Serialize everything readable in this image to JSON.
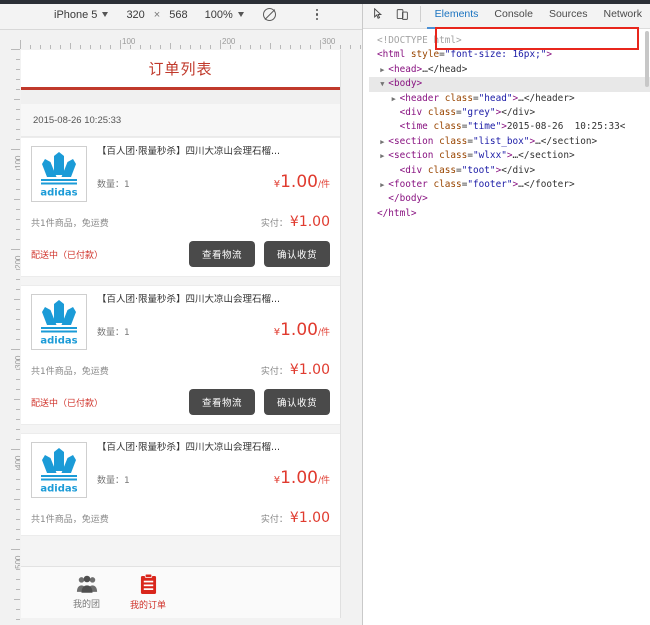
{
  "device_toolbar": {
    "device_name": "iPhone 5",
    "width": "320",
    "height": "568",
    "separator": "×",
    "zoom": "100%",
    "throttle_icon": "no-throttling-icon",
    "more_icon": "more-vertical-icon"
  },
  "rulers": {
    "horizontal_labels": [
      "100",
      "200",
      "300"
    ],
    "vertical_labels": [
      "100",
      "200",
      "300",
      "400",
      "500"
    ]
  },
  "phone": {
    "header_title": "订单列表",
    "time": "2015-08-26 10:25:33",
    "orders": [
      {
        "thumb_alt": "adidas-logo",
        "title": "【百人团·限量秒杀】四川大凉山会理石榴...",
        "qty_label": "数量：1",
        "unit_currency": "¥",
        "unit_price": "1.00",
        "unit_suffix": "/件",
        "summary_left": "共1件商品，免运费",
        "summary_right_label": "实付：",
        "summary_currency": "¥",
        "summary_amount": "1.00",
        "status": "配送中（已付款）",
        "btn_logistics": "查看物流",
        "btn_confirm": "确认收货"
      },
      {
        "thumb_alt": "adidas-logo",
        "title": "【百人团·限量秒杀】四川大凉山会理石榴...",
        "qty_label": "数量：1",
        "unit_currency": "¥",
        "unit_price": "1.00",
        "unit_suffix": "/件",
        "summary_left": "共1件商品，免运费",
        "summary_right_label": "实付：",
        "summary_currency": "¥",
        "summary_amount": "1.00",
        "status": "配送中（已付款）",
        "btn_logistics": "查看物流",
        "btn_confirm": "确认收货"
      },
      {
        "thumb_alt": "adidas-logo",
        "title": "【百人团·限量秒杀】四川大凉山会理石榴...",
        "qty_label": "数量：1",
        "unit_currency": "¥",
        "unit_price": "1.00",
        "unit_suffix": "/件",
        "summary_left": "共1件商品，免运费",
        "summary_right_label": "实付：",
        "summary_currency": "¥",
        "summary_amount": "1.00",
        "status": "",
        "btn_logistics": "",
        "btn_confirm": ""
      }
    ],
    "tabbar": [
      {
        "label": "我的团",
        "icon": "group-people-icon",
        "active": false
      },
      {
        "label": "我的订单",
        "icon": "clipboard-list-icon",
        "active": true
      }
    ]
  },
  "devtools": {
    "inspect_icon": "inspect-cursor-icon",
    "device_toggle_icon": "device-toolbar-icon",
    "tabs": [
      {
        "label": "Elements",
        "active": true
      },
      {
        "label": "Console",
        "active": false
      },
      {
        "label": "Sources",
        "active": false
      },
      {
        "label": "Network",
        "active": false
      }
    ],
    "dom_lines": [
      {
        "indent": 0,
        "arrow": "",
        "text": "<!DOCTYPE html>",
        "kind": "doctype"
      },
      {
        "indent": 0,
        "arrow": "",
        "text": "<html style=\"font-size: 16px;\">",
        "kind": "tag"
      },
      {
        "indent": 1,
        "arrow": "▶",
        "text": "<head>…</head>",
        "kind": "tag"
      },
      {
        "indent": 1,
        "arrow": "▼",
        "text": "<body>",
        "kind": "tag",
        "selected": true
      },
      {
        "indent": 2,
        "arrow": "▶",
        "text": "<header class=\"head\">…</header>",
        "kind": "tag"
      },
      {
        "indent": 2,
        "arrow": "",
        "text": "<div class=\"grey\"></div>",
        "kind": "tag"
      },
      {
        "indent": 2,
        "arrow": "",
        "text": "<time class=\"time\">2015-08-26  10:25:33<",
        "kind": "tag"
      },
      {
        "indent": 1,
        "arrow": "▶",
        "text": "<section class=\"list_box\">…</section>",
        "kind": "tag"
      },
      {
        "indent": 1,
        "arrow": "▶",
        "text": "<section class=\"wlxx\">…</section>",
        "kind": "tag"
      },
      {
        "indent": 2,
        "arrow": "",
        "text": "<div class=\"toot\"></div>",
        "kind": "tag"
      },
      {
        "indent": 1,
        "arrow": "▶",
        "text": "<footer class=\"footer\">…</footer>",
        "kind": "tag"
      },
      {
        "indent": 1,
        "arrow": "",
        "text": "</body>",
        "kind": "tag"
      },
      {
        "indent": 0,
        "arrow": "",
        "text": "</html>",
        "kind": "tag"
      }
    ],
    "highlight_box_color": "#e8261c"
  }
}
